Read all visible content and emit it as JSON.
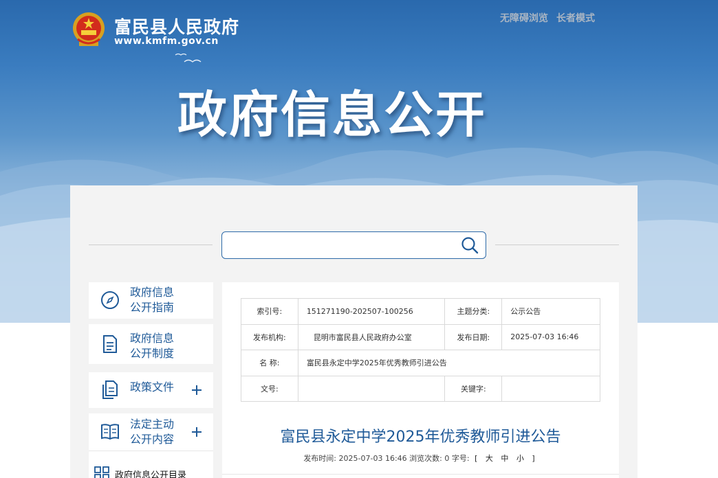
{
  "header": {
    "site_name": "富民县人民政府",
    "site_url": "www.kmfm.gov.cn",
    "links": [
      "无障碍浏览",
      "长者模式"
    ],
    "hero_title": "政府信息公开"
  },
  "search": {
    "value": "",
    "placeholder": ""
  },
  "sidebar": {
    "items": [
      {
        "label": "政府信息\n公开指南",
        "icon": "compass-icon",
        "expandable": false
      },
      {
        "label": "政府信息\n公开制度",
        "icon": "document-icon",
        "expandable": false
      },
      {
        "label": "政策文件",
        "icon": "files-icon",
        "expandable": true
      },
      {
        "label": "法定主动\n公开内容",
        "icon": "book-icon",
        "expandable": true
      }
    ],
    "sub": {
      "label": "政府信息公开目录",
      "icon": "grid-icon"
    }
  },
  "meta": {
    "index_label": "索引号:",
    "index_value": "151271190-202507-100256",
    "topic_label": "主题分类:",
    "topic_value": "公示公告",
    "org_label": "发布机构:",
    "org_value": "昆明市富民县人民政府办公室",
    "date_label": "发布日期:",
    "date_value": "2025-07-03 16:46",
    "name_label": "名 称:",
    "name_value": "富民县永定中学2025年优秀教师引进公告",
    "docno_label": "文号:",
    "docno_value": "",
    "keyword_label": "关键字:",
    "keyword_value": ""
  },
  "article": {
    "title": "富民县永定中学2025年优秀教师引进公告",
    "publish_prefix": "发布时间:",
    "publish_time": "2025-07-03 16:46",
    "views_prefix": "浏览次数:",
    "views": "0",
    "fontsize_prefix": "字号:",
    "bracket_open": "[",
    "size_large": "大",
    "size_medium": "中",
    "size_small": "小",
    "bracket_close": "]"
  },
  "colors": {
    "accent": "#1f5a98",
    "banner_top": "#2a69ad"
  }
}
